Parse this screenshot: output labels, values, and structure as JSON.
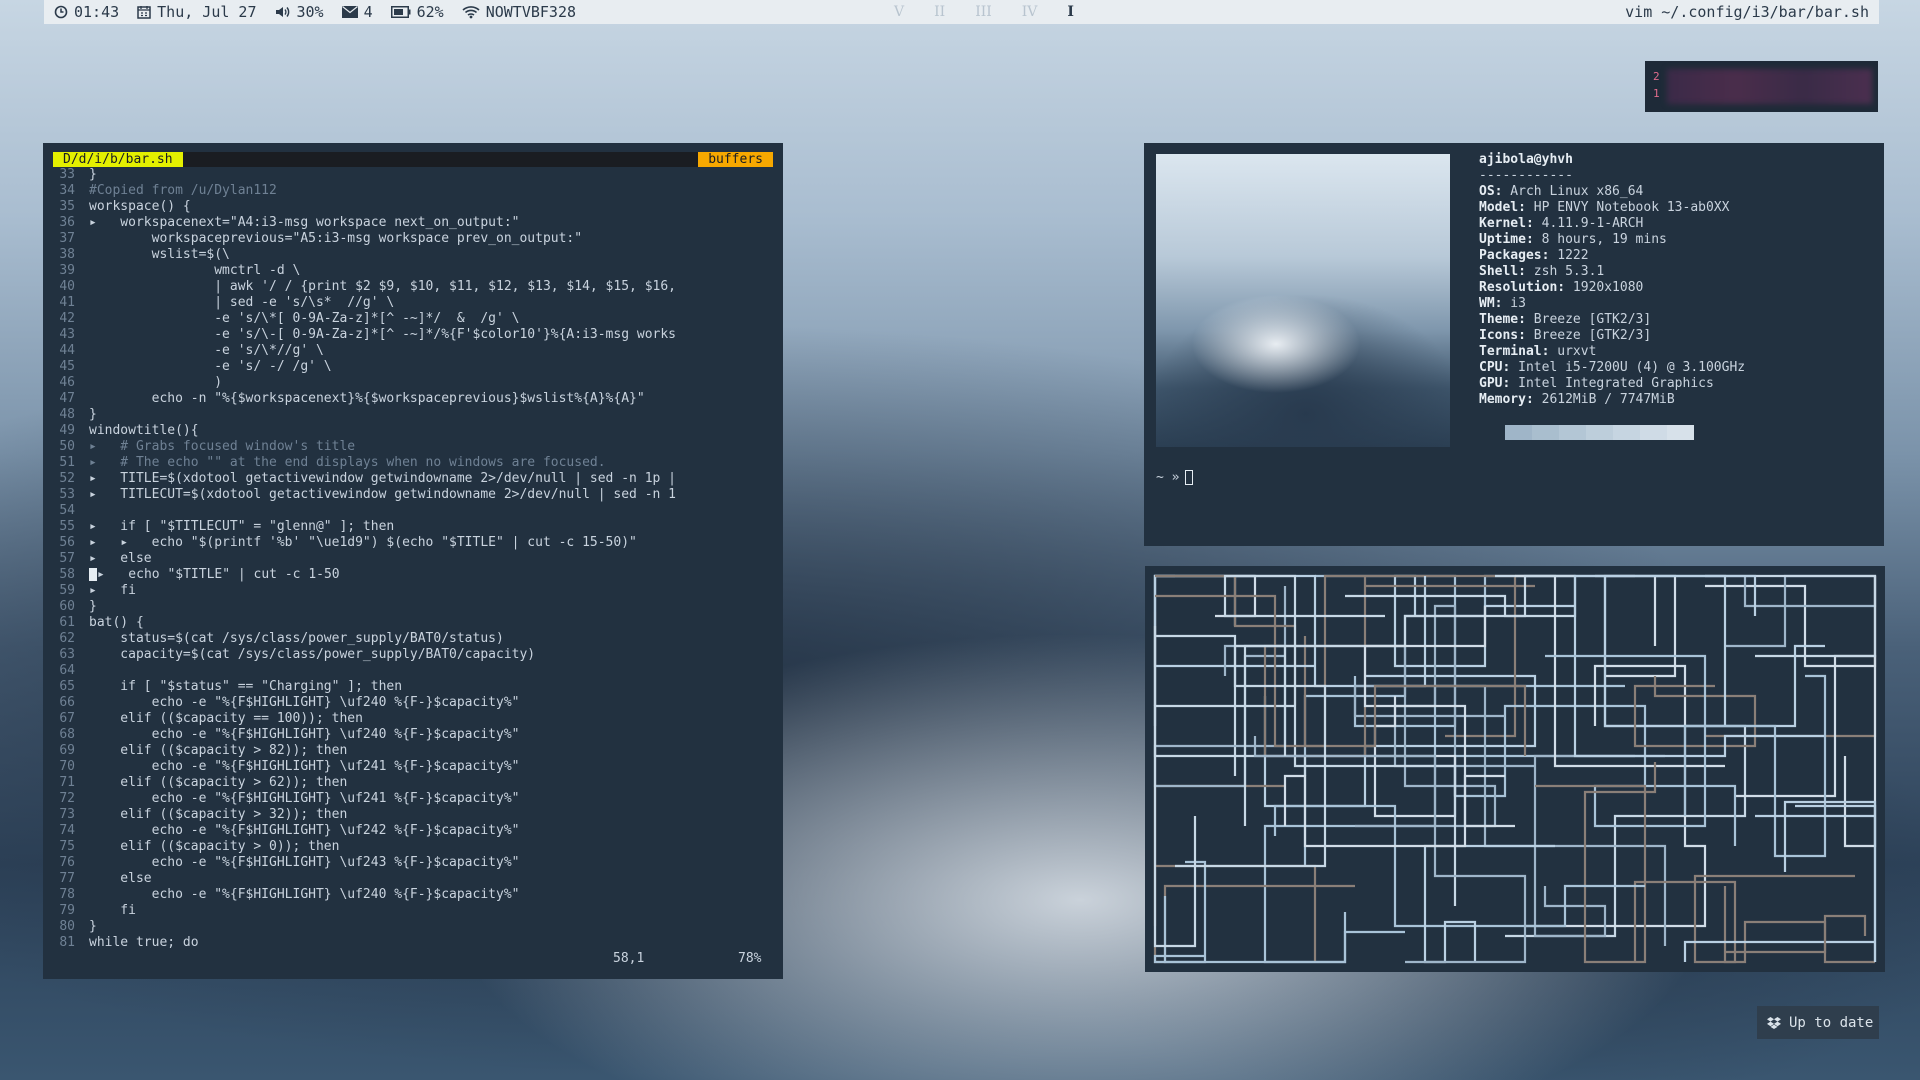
{
  "statusbar": {
    "time": "01:43",
    "date": "Thu, Jul 27",
    "volume": "30%",
    "mail": "4",
    "battery": "62%",
    "wifi": "NOWTVBF328",
    "workspaces": [
      "V",
      "II",
      "III",
      "IV",
      "I"
    ],
    "active_workspace": "I",
    "window_title": "vim ~/.config/i3/bar/bar.sh",
    "icons": [
      "clock-icon",
      "calendar-icon",
      "volume-icon",
      "mail-icon",
      "battery-icon",
      "wifi-icon"
    ]
  },
  "widget": {
    "line1": "2",
    "line2": "1"
  },
  "vim": {
    "file_tab": "D/d/i/b/bar.sh",
    "buffers_label": "buffers",
    "lines": [
      {
        "n": "33",
        "t": "}"
      },
      {
        "n": "34",
        "t": "#Copied from /u/Dylan112",
        "c": true
      },
      {
        "n": "35",
        "t": "workspace() {"
      },
      {
        "n": "36",
        "t": "▸   workspacenext=\"A4:i3-msg workspace next_on_output:\""
      },
      {
        "n": "37",
        "t": "        workspaceprevious=\"A5:i3-msg workspace prev_on_output:\""
      },
      {
        "n": "38",
        "t": "        wslist=$(\\"
      },
      {
        "n": "39",
        "t": "                wmctrl -d \\"
      },
      {
        "n": "40",
        "t": "                | awk '/ / {print $2 $9, $10, $11, $12, $13, $14, $15, $16,"
      },
      {
        "n": "41",
        "t": "                | sed -e 's/\\s*  //g' \\"
      },
      {
        "n": "42",
        "t": "                -e 's/\\*[ 0-9A-Za-z]*[^ -~]*/  &  /g' \\"
      },
      {
        "n": "43",
        "t": "                -e 's/\\-[ 0-9A-Za-z]*[^ -~]*/%{F'$color10'}%{A:i3-msg works"
      },
      {
        "n": "44",
        "t": "                -e 's/\\*//g' \\"
      },
      {
        "n": "45",
        "t": "                -e 's/ -/ /g' \\"
      },
      {
        "n": "46",
        "t": "                )"
      },
      {
        "n": "47",
        "t": "        echo -n \"%{$workspacenext}%{$workspaceprevious}$wslist%{A}%{A}\""
      },
      {
        "n": "48",
        "t": "}"
      },
      {
        "n": "49",
        "t": "windowtitle(){"
      },
      {
        "n": "50",
        "t": "▸   # Grabs focused window's title",
        "c": true
      },
      {
        "n": "51",
        "t": "▸   # The echo \"\" at the end displays when no windows are focused.",
        "c": true
      },
      {
        "n": "52",
        "t": "▸   TITLE=$(xdotool getactivewindow getwindowname 2>/dev/null | sed -n 1p |"
      },
      {
        "n": "53",
        "t": "▸   TITLECUT=$(xdotool getactivewindow getwindowname 2>/dev/null | sed -n 1"
      },
      {
        "n": "54",
        "t": ""
      },
      {
        "n": "55",
        "t": "▸   if [ \"$TITLECUT\" = \"glenn@\" ]; then"
      },
      {
        "n": "56",
        "t": "▸   ▸   echo \"$(printf '%b' \"\\ue1d9\") $(echo \"$TITLE\" | cut -c 15-50)\""
      },
      {
        "n": "57",
        "t": "▸   else"
      },
      {
        "n": "58",
        "t": "CURSOR▸   echo \"$TITLE\" | cut -c 1-50"
      },
      {
        "n": "59",
        "t": "▸   fi"
      },
      {
        "n": "60",
        "t": "}"
      },
      {
        "n": "61",
        "t": "bat() {"
      },
      {
        "n": "62",
        "t": "    status=$(cat /sys/class/power_supply/BAT0/status)"
      },
      {
        "n": "63",
        "t": "    capacity=$(cat /sys/class/power_supply/BAT0/capacity)"
      },
      {
        "n": "64",
        "t": ""
      },
      {
        "n": "65",
        "t": "    if [ \"$status\" == \"Charging\" ]; then"
      },
      {
        "n": "66",
        "t": "        echo -e \"%{F$HIGHLIGHT} \\uf240 %{F-}$capacity%\""
      },
      {
        "n": "67",
        "t": "    elif (($capacity == 100)); then"
      },
      {
        "n": "68",
        "t": "        echo -e \"%{F$HIGHLIGHT} \\uf240 %{F-}$capacity%\""
      },
      {
        "n": "69",
        "t": "    elif (($capacity > 82)); then"
      },
      {
        "n": "70",
        "t": "        echo -e \"%{F$HIGHLIGHT} \\uf241 %{F-}$capacity%\""
      },
      {
        "n": "71",
        "t": "    elif (($capacity > 62)); then"
      },
      {
        "n": "72",
        "t": "        echo -e \"%{F$HIGHLIGHT} \\uf241 %{F-}$capacity%\""
      },
      {
        "n": "73",
        "t": "    elif (($capacity > 32)); then"
      },
      {
        "n": "74",
        "t": "        echo -e \"%{F$HIGHLIGHT} \\uf242 %{F-}$capacity%\""
      },
      {
        "n": "75",
        "t": "    elif (($capacity > 0)); then"
      },
      {
        "n": "76",
        "t": "        echo -e \"%{F$HIGHLIGHT} \\uf243 %{F-}$capacity%\""
      },
      {
        "n": "77",
        "t": "    else"
      },
      {
        "n": "78",
        "t": "        echo -e \"%{F$HIGHLIGHT} \\uf240 %{F-}$capacity%\""
      },
      {
        "n": "79",
        "t": "    fi"
      },
      {
        "n": "80",
        "t": "}"
      },
      {
        "n": "81",
        "t": "while true; do"
      }
    ],
    "cursor_pos": "58,1",
    "percent": "78%"
  },
  "neofetch": {
    "user_host": "ajibola@yhvh",
    "separator": "------------",
    "rows": [
      {
        "k": "OS:",
        "v": " Arch Linux x86_64"
      },
      {
        "k": "Model:",
        "v": " HP ENVY Notebook 13-ab0XX"
      },
      {
        "k": "Kernel:",
        "v": " 4.11.9-1-ARCH"
      },
      {
        "k": "Uptime:",
        "v": " 8 hours, 19 mins"
      },
      {
        "k": "Packages:",
        "v": " 1222"
      },
      {
        "k": "Shell:",
        "v": " zsh 5.3.1"
      },
      {
        "k": "Resolution:",
        "v": " 1920x1080"
      },
      {
        "k": "WM:",
        "v": " i3"
      },
      {
        "k": "Theme:",
        "v": " Breeze [GTK2/3]"
      },
      {
        "k": "Icons:",
        "v": " Breeze [GTK2/3]"
      },
      {
        "k": "Terminal:",
        "v": " urxvt"
      },
      {
        "k": "CPU:",
        "v": " Intel i5-7200U (4) @ 3.100GHz"
      },
      {
        "k": "GPU:",
        "v": " Intel Integrated Graphics"
      },
      {
        "k": "Memory:",
        "v": " 2612MiB / 7747MiB"
      }
    ],
    "palette": [
      "#9fb5c8",
      "#a9bece",
      "#b3c6d5",
      "#bdcedb",
      "#c6d5e1",
      "#cfdbe6",
      "#d7e1ea"
    ],
    "prompt": "~ »"
  },
  "notification": {
    "label": "Up to date",
    "icon": "dropbox-icon"
  }
}
